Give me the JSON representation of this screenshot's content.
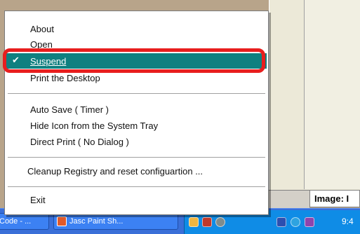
{
  "menu": {
    "items": [
      {
        "label": "About"
      },
      {
        "label": "Open"
      },
      {
        "label": "Suspend",
        "checked": true,
        "selected": true
      },
      {
        "label": "Print the Desktop"
      },
      {
        "label": "Auto Save ( Timer )"
      },
      {
        "label": "Hide Icon from the System Tray"
      },
      {
        "label": "Direct Print ( No Dialog )"
      },
      {
        "label": "Cleanup Registry and reset configuartion ..."
      },
      {
        "label": "Exit"
      }
    ],
    "check_glyph": "✔",
    "highlight_color": "#e81e1e",
    "selection_color": "#0f8080"
  },
  "background": {
    "image_label": "Image: I"
  },
  "taskbar": {
    "button1_label": "Code - ...",
    "button2_label": "Jasc Paint Sh...",
    "clock": "9:4",
    "tray_icons": [
      "paint-tray-icon",
      "shield-tray-icon",
      "network-tray-icon",
      "antivirus-tray-icon",
      "refresh-tray-icon",
      "tool-tray-icon"
    ]
  }
}
